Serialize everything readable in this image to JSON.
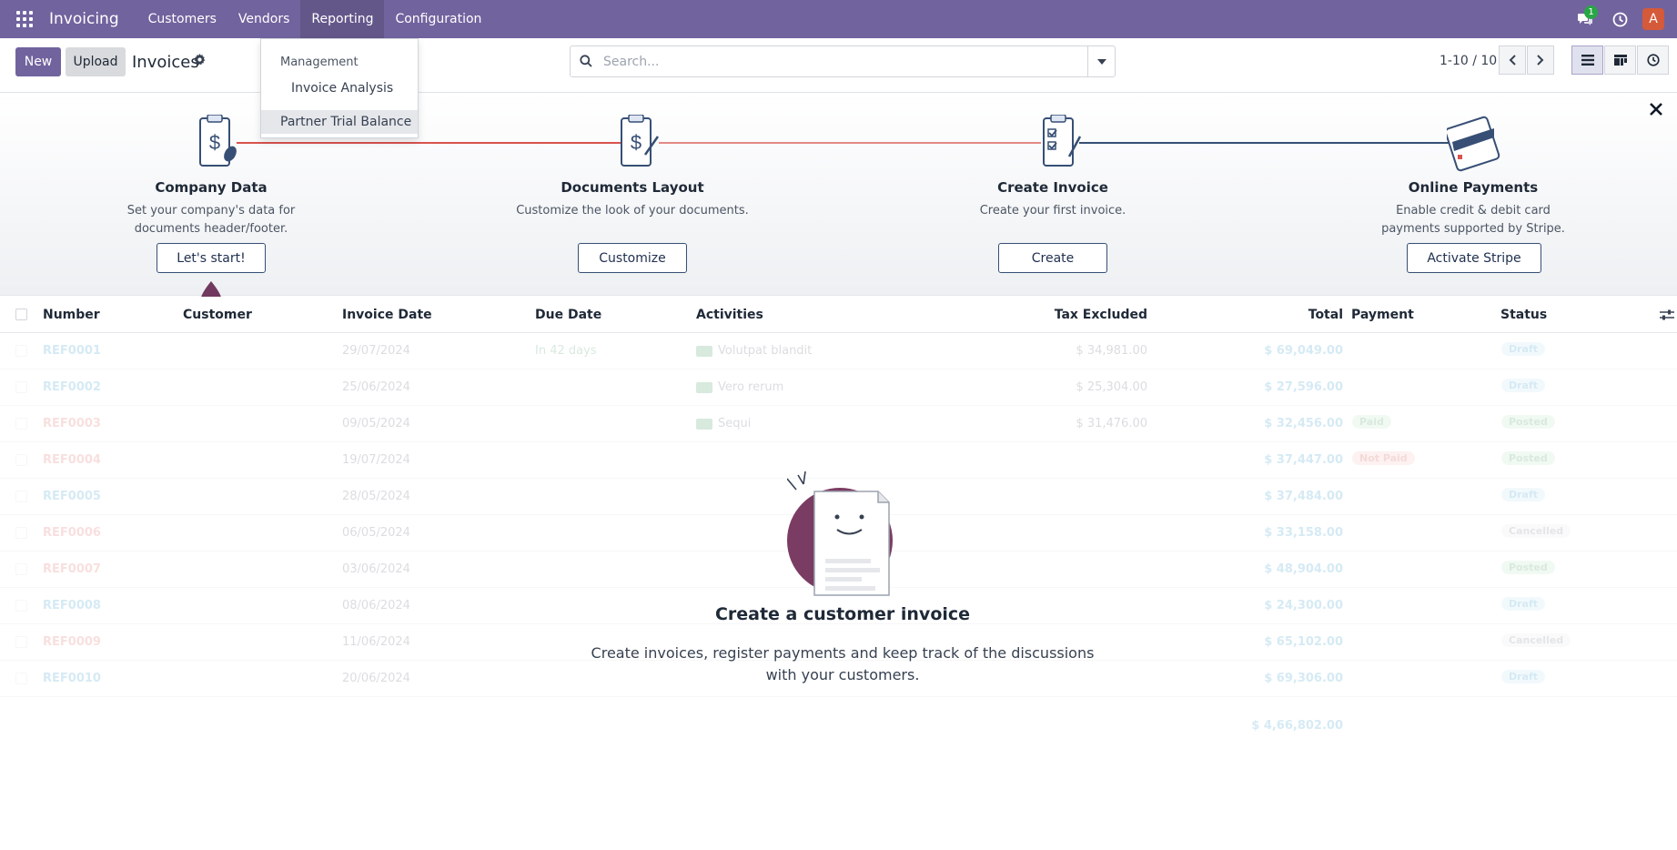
{
  "navbar": {
    "brand": "Invoicing",
    "menu": [
      "Customers",
      "Vendors",
      "Reporting",
      "Configuration"
    ],
    "chat_badge": "1",
    "avatar_initial": "A"
  },
  "reporting_menu": {
    "header": "Management",
    "items": [
      "Invoice Analysis",
      "Partner Trial Balance"
    ]
  },
  "control": {
    "new_label": "New",
    "upload_label": "Upload",
    "title": "Invoices",
    "search_placeholder": "Search...",
    "pager": "1-10 / 10"
  },
  "onboarding": {
    "steps": [
      {
        "title": "Company Data",
        "desc": "Set your company's data for documents header/footer.",
        "button": "Let's start!"
      },
      {
        "title": "Documents Layout",
        "desc": "Customize the look of your documents.",
        "button": "Customize"
      },
      {
        "title": "Create Invoice",
        "desc": "Create your first invoice.",
        "button": "Create"
      },
      {
        "title": "Online Payments",
        "desc": "Enable credit & debit card payments supported by Stripe.",
        "button": "Activate Stripe"
      }
    ]
  },
  "table": {
    "columns": [
      "Number",
      "Customer",
      "Invoice Date",
      "Due Date",
      "Activities",
      "Tax Excluded",
      "Total",
      "Payment",
      "Status"
    ],
    "rows": [
      {
        "number": "REF0001",
        "date": "29/07/2024",
        "due": "In 42 days",
        "activity": "Volutpat blandit",
        "tax": "$ 34,981.00",
        "total": "$ 69,049.00",
        "payment": "",
        "status": "Draft"
      },
      {
        "number": "REF0002",
        "date": "25/06/2024",
        "due": "",
        "activity": "Vero rerum",
        "tax": "$ 25,304.00",
        "total": "$ 27,596.00",
        "payment": "",
        "status": "Draft"
      },
      {
        "number": "REF0003",
        "date": "09/05/2024",
        "due": "",
        "activity": "Sequi",
        "tax": "$ 31,476.00",
        "total": "$ 32,456.00",
        "payment": "Paid",
        "status": "Posted"
      },
      {
        "number": "REF0004",
        "date": "19/07/2024",
        "due": "",
        "activity": "",
        "tax": "",
        "total": "$ 37,447.00",
        "payment": "Not Paid",
        "status": "Posted"
      },
      {
        "number": "REF0005",
        "date": "28/05/2024",
        "due": "",
        "activity": "",
        "tax": "",
        "total": "$ 37,484.00",
        "payment": "",
        "status": "Draft"
      },
      {
        "number": "REF0006",
        "date": "06/05/2024",
        "due": "",
        "activity": "",
        "tax": "",
        "total": "$ 33,158.00",
        "payment": "",
        "status": "Cancelled"
      },
      {
        "number": "REF0007",
        "date": "03/06/2024",
        "due": "",
        "activity": "",
        "tax": "",
        "total": "$ 48,904.00",
        "payment": "",
        "status": "Posted"
      },
      {
        "number": "REF0008",
        "date": "08/06/2024",
        "due": "",
        "activity": "",
        "tax": "",
        "total": "$ 24,300.00",
        "payment": "",
        "status": "Draft"
      },
      {
        "number": "REF0009",
        "date": "11/06/2024",
        "due": "",
        "activity": "",
        "tax": "",
        "total": "$ 65,102.00",
        "payment": "",
        "status": "Cancelled"
      },
      {
        "number": "REF0010",
        "date": "20/06/2024",
        "due": "",
        "activity": "",
        "tax": "",
        "total": "$ 69,306.00",
        "payment": "",
        "status": "Draft"
      }
    ],
    "grand_total": "$ 4,66,802.00"
  },
  "empty_state": {
    "title": "Create a customer invoice",
    "text": "Create invoices, register payments and keep track of the discussions with your customers."
  },
  "colors": {
    "navbar": "#71639e",
    "primary": "#71639e",
    "progress_line_done": "#d9534f",
    "progress_line_todo": "#374f75"
  }
}
